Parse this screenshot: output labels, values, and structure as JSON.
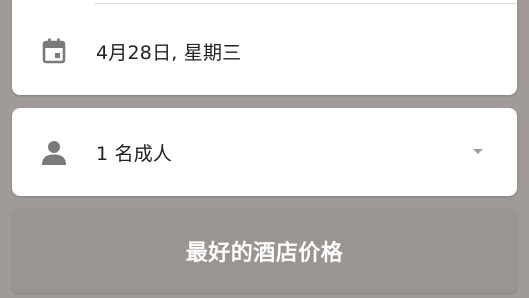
{
  "search_form": {
    "date": {
      "icon": "calendar-icon",
      "value": "4月28日, 星期三"
    },
    "guests": {
      "icon": "person-icon",
      "value": "1 名成人",
      "dropdown_icon": "dropdown-arrow-icon"
    },
    "search_button_label": "最好的酒店价格"
  },
  "colors": {
    "overlay_background": "#a09b98",
    "card_background": "#ffffff",
    "button_background": "#9a9591",
    "icon_color": "#7a7a7a",
    "text_color": "#202124"
  }
}
